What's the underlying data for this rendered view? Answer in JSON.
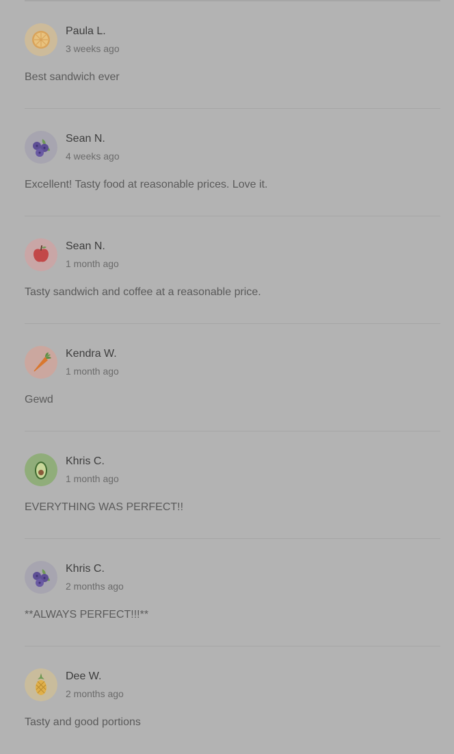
{
  "reviews": [
    {
      "name": "Paula L.",
      "time": "3 weeks ago",
      "text": "Best sandwich ever",
      "avatar_icon": "orange-slice-icon"
    },
    {
      "name": "Sean N.",
      "time": "4 weeks ago",
      "text": "Excellent! Tasty food at reasonable prices. Love it.",
      "avatar_icon": "blueberries-icon"
    },
    {
      "name": "Sean N.",
      "time": "1 month ago",
      "text": "Tasty sandwich and coffee at a reasonable price.",
      "avatar_icon": "apple-icon"
    },
    {
      "name": "Kendra W.",
      "time": "1 month ago",
      "text": "Gewd",
      "avatar_icon": "carrot-icon"
    },
    {
      "name": "Khris C.",
      "time": "1 month ago",
      "text": "EVERYTHING WAS PERFECT!!",
      "avatar_icon": "avocado-icon"
    },
    {
      "name": "Khris C.",
      "time": "2 months ago",
      "text": "**ALWAYS PERFECT!!!**",
      "avatar_icon": "blueberries-icon"
    },
    {
      "name": "Dee W.",
      "time": "2 months ago",
      "text": "Tasty and good portions",
      "avatar_icon": "pineapple-icon"
    }
  ]
}
